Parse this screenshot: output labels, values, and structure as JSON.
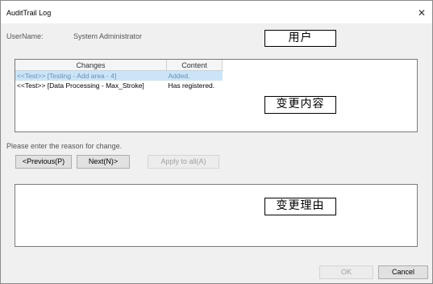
{
  "window": {
    "title": "AuditTrail Log",
    "close_icon": "close-icon"
  },
  "user": {
    "label": "UserName:",
    "value": "System Administrator"
  },
  "table": {
    "headers": [
      "Changes",
      "Content"
    ],
    "rows": [
      {
        "changes": "<<Test>> [Testing - Add area - 4]",
        "content": "Added."
      },
      {
        "changes": "<<Test>> [Data Processing - Max_Stroke]",
        "content": "Has registered."
      }
    ]
  },
  "reason": {
    "prompt": "Please enter the reason for change.",
    "prev_label": "<Previous(P)",
    "next_label": "Next(N)>",
    "apply_label": "Apply to all(A)"
  },
  "buttons": {
    "ok_label": "OK",
    "cancel_label": "Cancel"
  },
  "annotations": {
    "user": "用户",
    "changes": "变更内容",
    "reason": "变更理由"
  }
}
